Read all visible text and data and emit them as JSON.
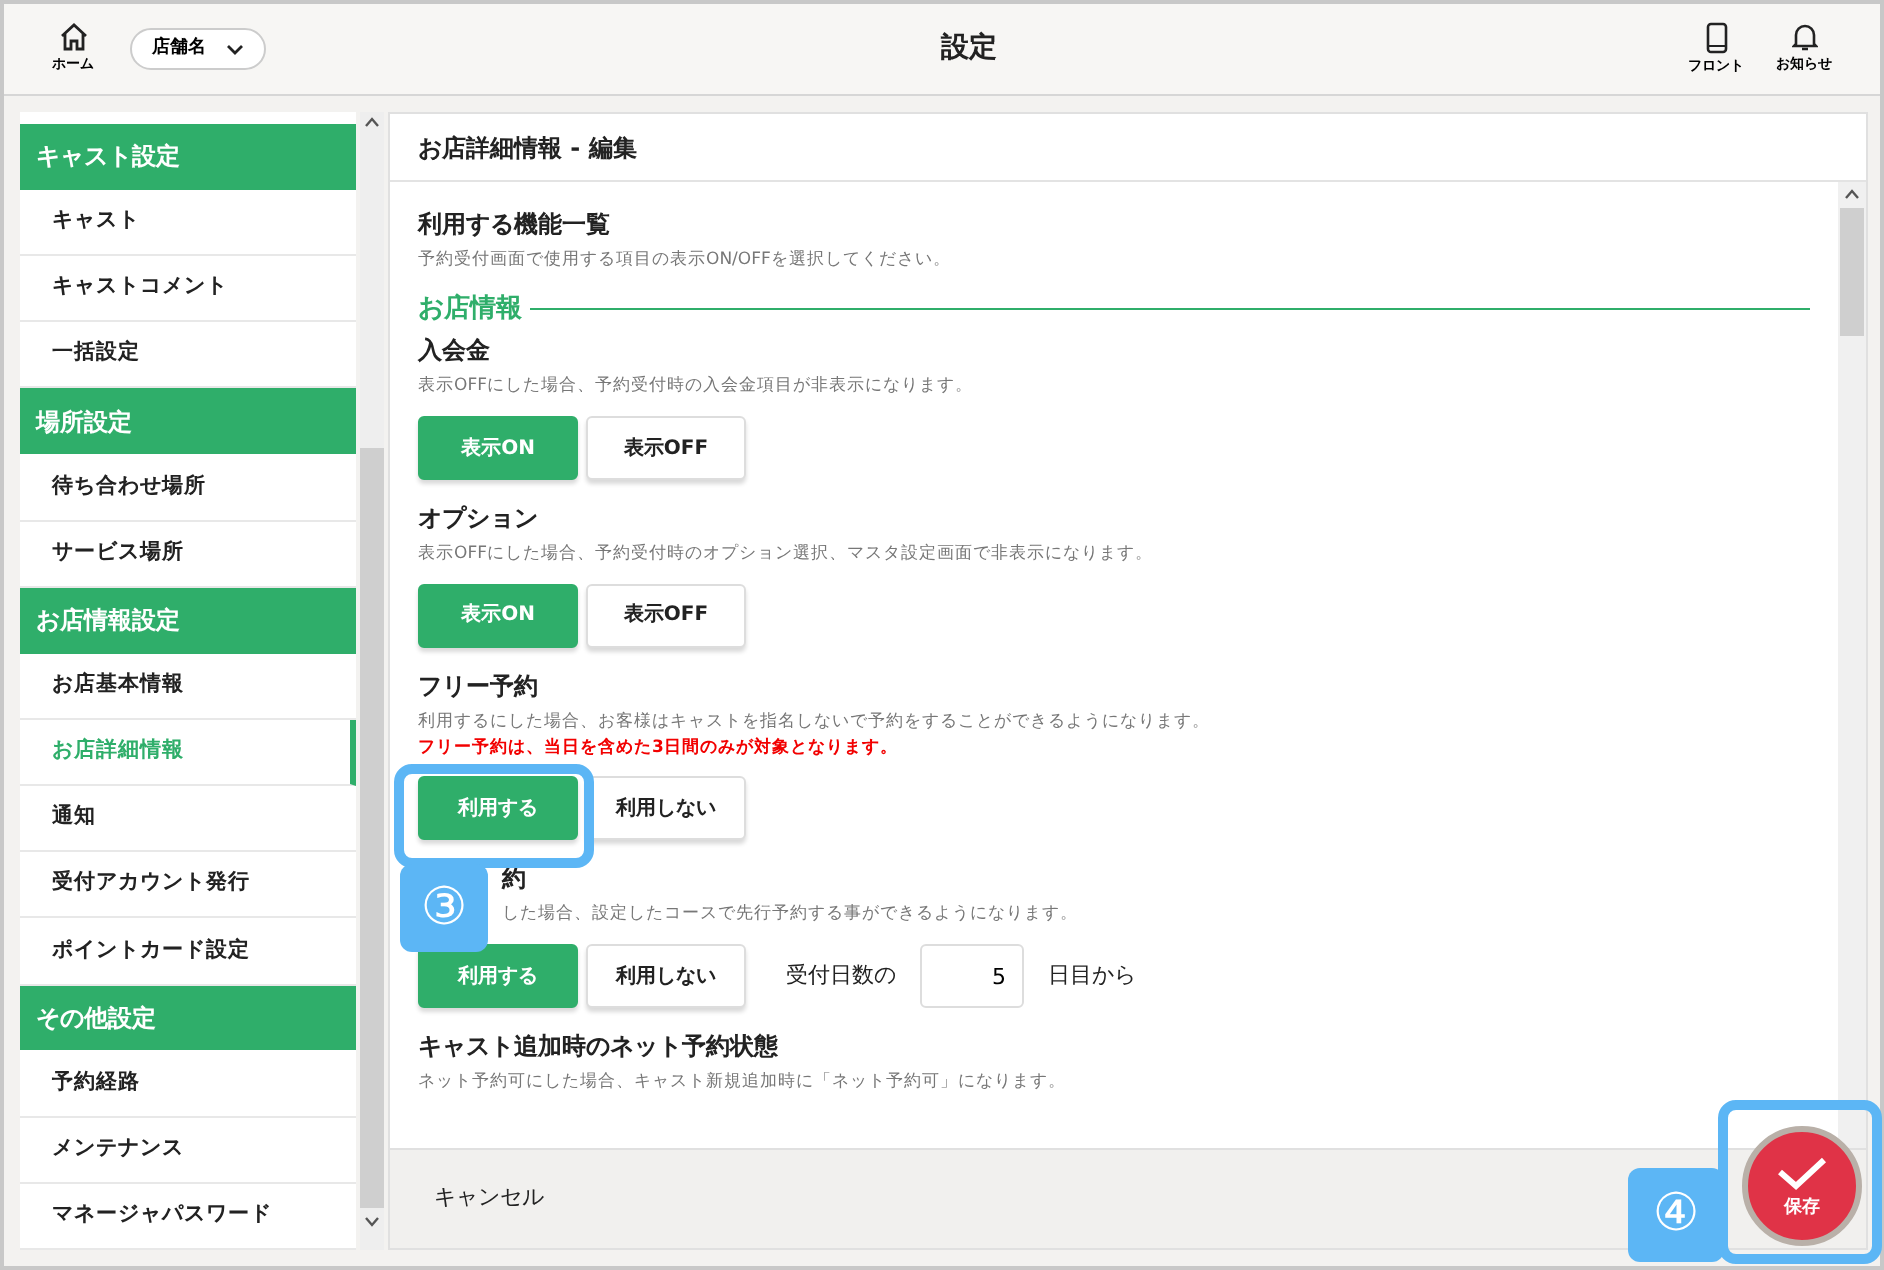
{
  "header": {
    "home_label": "ホーム",
    "store_select": "店舗名",
    "title": "設定",
    "front_label": "フロント",
    "notice_label": "お知らせ"
  },
  "sidebar": {
    "groups": [
      {
        "title": "キャスト設定",
        "items": [
          {
            "label": "キャスト",
            "selected": false
          },
          {
            "label": "キャストコメント",
            "selected": false
          },
          {
            "label": "一括設定",
            "selected": false
          }
        ]
      },
      {
        "title": "場所設定",
        "items": [
          {
            "label": "待ち合わせ場所",
            "selected": false
          },
          {
            "label": "サービス場所",
            "selected": false
          }
        ]
      },
      {
        "title": "お店情報設定",
        "items": [
          {
            "label": "お店基本情報",
            "selected": false
          },
          {
            "label": "お店詳細情報",
            "selected": true
          },
          {
            "label": "通知",
            "selected": false
          },
          {
            "label": "受付アカウント発行",
            "selected": false
          },
          {
            "label": "ポイントカード設定",
            "selected": false
          }
        ]
      },
      {
        "title": "その他設定",
        "items": [
          {
            "label": "予約経路",
            "selected": false
          },
          {
            "label": "メンテナンス",
            "selected": false
          },
          {
            "label": "マネージャパスワード",
            "selected": false
          }
        ]
      }
    ]
  },
  "panel": {
    "title": "お店詳細情報 - 編集",
    "intro_title": "利用する機能一覧",
    "intro_text": "予約受付画面で使用する項目の表示ON/OFFを選択してください。",
    "section_title": "お店情報",
    "settings": [
      {
        "title": "入会金",
        "description": "表示OFFにした場合、予約受付時の入会金項目が非表示になります。",
        "options": [
          {
            "label": "表示ON",
            "selected": true
          },
          {
            "label": "表示OFF",
            "selected": false
          }
        ]
      },
      {
        "title": "オプション",
        "description": "表示OFFにした場合、予約受付時のオプション選択、マスタ設定画面で非表示になります。",
        "options": [
          {
            "label": "表示ON",
            "selected": true
          },
          {
            "label": "表示OFF",
            "selected": false
          }
        ]
      },
      {
        "title": "フリー予約",
        "description": "利用するにした場合、お客様はキャストを指名しないで予約をすることができるようになります。",
        "warning": "フリー予約は、当日を含めた3日間のみが対象となります。",
        "options": [
          {
            "label": "利用する",
            "selected": true
          },
          {
            "label": "利用しない",
            "selected": false
          }
        ]
      },
      {
        "title": "約",
        "description": "した場合、設定したコースで先行予約する事ができるようになります。",
        "options": [
          {
            "label": "利用する",
            "selected": true
          },
          {
            "label": "利用しない",
            "selected": false
          }
        ],
        "days": {
          "prefix": "受付日数の",
          "value": "5",
          "suffix": "日目から"
        }
      },
      {
        "title": "キャスト追加時のネット予約状態",
        "description": "ネット予約可にした場合、キャスト新規追加時に「ネット予約可」になります。"
      }
    ]
  },
  "footer": {
    "cancel": "キャンセル",
    "save": "保存"
  },
  "callouts": [
    "③",
    "④"
  ]
}
